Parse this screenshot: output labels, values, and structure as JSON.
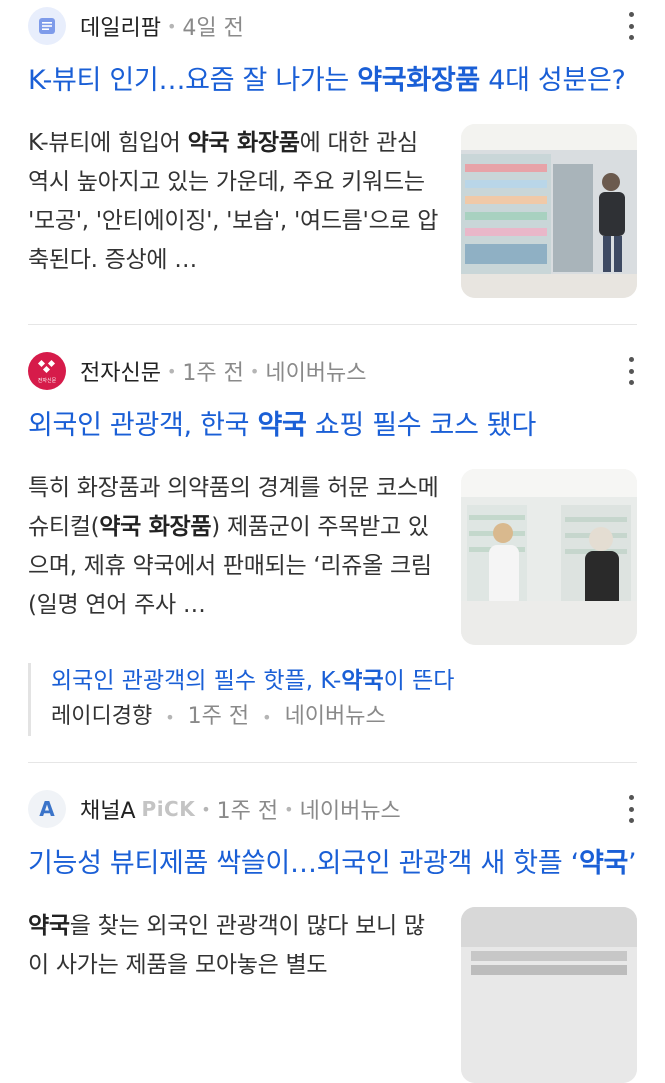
{
  "articles": [
    {
      "source": "데일리팜",
      "age": "4일 전",
      "platform": "",
      "title_pre": "K-뷰티 인기…요즘 잘 나가는 ",
      "title_bold": "약국화장품",
      "title_post": " 4대 성분은?",
      "snippet_pre": "K-뷰티에 힘입어 ",
      "snippet_bold": "약국 화장품",
      "snippet_post": "에 대한 관심 역시 높아지고 있는 가운데, 주요 키워드는 '모공', '안티에이징', '보습', '여드름'으로 압축된다. 증상에 …",
      "logo_icon": "document-icon"
    },
    {
      "source": "전자신문",
      "age": "1주 전",
      "platform": "네이버뉴스",
      "title_pre": "외국인 관광객, 한국 ",
      "title_bold": "약국",
      "title_post": " 쇼핑 필수 코스 됐다",
      "snippet_pre": "특히 화장품과 의약품의 경계를 허문 코스메슈티컬(",
      "snippet_bold": "약국 화장품",
      "snippet_post": ") 제품군이 주목받고 있으며, 제휴 약국에서 판매되는 ‘리쥬올 크림(일명 연어 주사 …",
      "related_title_pre": "외국인 관광객의 필수 핫플, K-",
      "related_title_bold": "약국",
      "related_title_post": "이 뜬다",
      "related_source": "레이디경향",
      "related_age": "1주 전",
      "related_platform": "네이버뉴스",
      "logo_text": "전자신문"
    },
    {
      "source": "채널A",
      "source_tag": "PiCK",
      "age": "1주 전",
      "platform": "네이버뉴스",
      "title_pre": "기능성 뷰티제품 싹쓸이…외국인 관광객 새 핫플 ‘",
      "title_bold": "약국",
      "title_post": "’",
      "snippet_bold": "약국",
      "snippet_post": "을 찾는 외국인 관광객이 많다 보니 많이 사가는 제품을 모아놓은 별도",
      "logo_letter": "A"
    }
  ],
  "colors": {
    "link": "#1a5fd6",
    "meta": "#8a8a8a"
  }
}
